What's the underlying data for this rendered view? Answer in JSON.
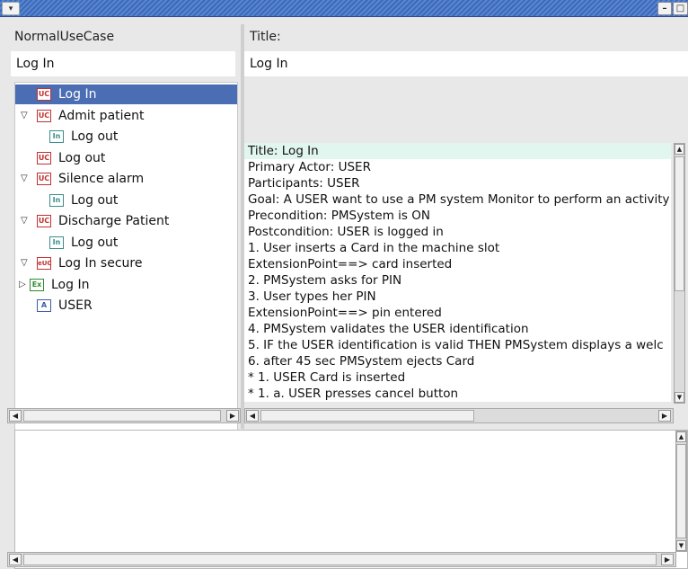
{
  "left": {
    "label": "NormalUseCase",
    "value": "Log In"
  },
  "right": {
    "title_label": "Title:",
    "title_value": "Log In"
  },
  "tree": [
    {
      "label": "Log In",
      "icon": "UC",
      "icon_name": "usecase-icon",
      "toggle": ""
    },
    {
      "label": "Admit patient",
      "icon": "UC",
      "icon_name": "usecase-icon",
      "toggle": "▽"
    },
    {
      "label": "Log out",
      "icon": "In",
      "icon_name": "include-icon",
      "toggle": ""
    },
    {
      "label": "Log out",
      "icon": "UC",
      "icon_name": "usecase-icon",
      "toggle": ""
    },
    {
      "label": "Silence alarm",
      "icon": "UC",
      "icon_name": "usecase-icon",
      "toggle": "▽"
    },
    {
      "label": "Log out",
      "icon": "In",
      "icon_name": "include-icon",
      "toggle": ""
    },
    {
      "label": "Discharge Patient",
      "icon": "UC",
      "icon_name": "usecase-icon",
      "toggle": "▽"
    },
    {
      "label": "Log out",
      "icon": "In",
      "icon_name": "include-icon",
      "toggle": ""
    },
    {
      "label": "Log In secure",
      "icon": "eUC",
      "icon_name": "extended-usecase-icon",
      "toggle": "▽"
    },
    {
      "label": "Log In",
      "icon": "Ex",
      "icon_name": "extension-icon",
      "toggle": "▷"
    },
    {
      "label": "USER",
      "icon": "A",
      "icon_name": "actor-icon",
      "toggle": ""
    }
  ],
  "detail_lines": [
    "Title: Log In",
    "Primary Actor: USER",
    "Participants: USER",
    "Goal: A USER want to use a PM system Monitor to perform an activity s",
    "Precondition: PMSystem is ON",
    "Postcondition: USER is logged in",
    " 1. User inserts a Card in the machine slot",
    "ExtensionPoint==> card inserted",
    " 2. PMSystem asks for PIN",
    " 3. User types her PIN",
    "ExtensionPoint==> pin entered",
    " 4. PMSystem validates the USER identification",
    " 5. IF the USER identification is valid THEN PMSystem displays a welc",
    " 6. after 45 sec PMSystem ejects Card",
    "* 1. USER Card is inserted",
    "*  1. a. USER presses cancel button"
  ],
  "colors": {
    "selection": "#4a6db3",
    "title_bar": "#3d6ab8",
    "highlight_line": "#e0f6ee"
  }
}
